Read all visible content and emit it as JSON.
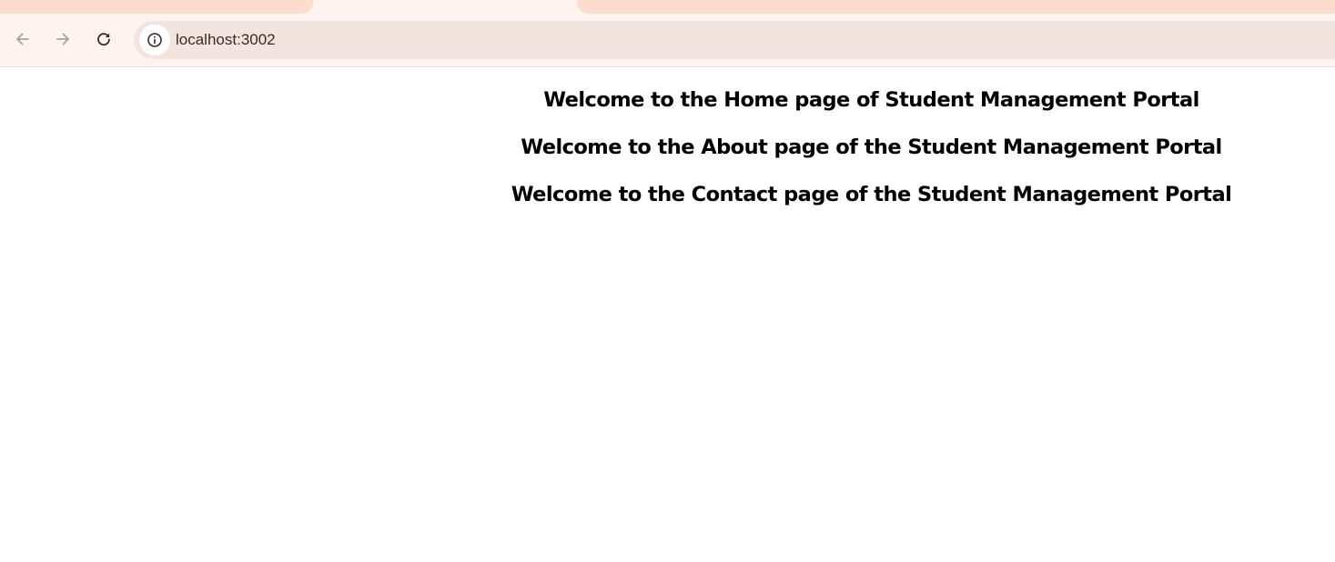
{
  "browser": {
    "address_bar": {
      "url": "localhost:3002",
      "site_info_icon": "info-icon"
    },
    "nav": {
      "back_icon": "arrow-left-icon",
      "forward_icon": "arrow-right-icon",
      "reload_icon": "reload-icon"
    },
    "colors": {
      "tab_strip": "#fff3ef",
      "inactive_tab": "#fcdccd",
      "omnibox": "#f4e4df"
    }
  },
  "page": {
    "headings": {
      "home": "Welcome to the Home page of Student Management Portal",
      "about": "Welcome to the About page of the Student Management Portal",
      "contact": "Welcome to the Contact page of the Student Management Portal"
    }
  }
}
